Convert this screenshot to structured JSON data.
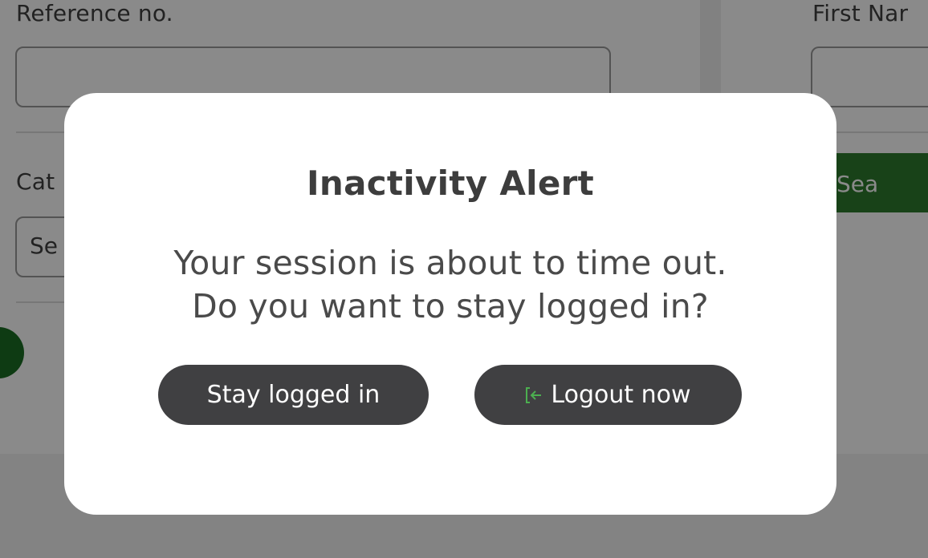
{
  "background": {
    "form": {
      "reference_label": "Reference no.",
      "first_name_label": "First Nar",
      "category_label": "Cat",
      "category_select_value": "Se",
      "search_button_label": "Sea"
    }
  },
  "modal": {
    "title": "Inactivity Alert",
    "message_line1": "Your session is about to time out.",
    "message_line2": "Do you want to stay logged in?",
    "stay_button_label": "Stay logged in",
    "logout_button_label": "Logout now",
    "logout_icon": "logout-icon"
  },
  "colors": {
    "button_bg": "#404042",
    "logout_icon": "#4caf50",
    "search_button": "#2d7a2d"
  }
}
